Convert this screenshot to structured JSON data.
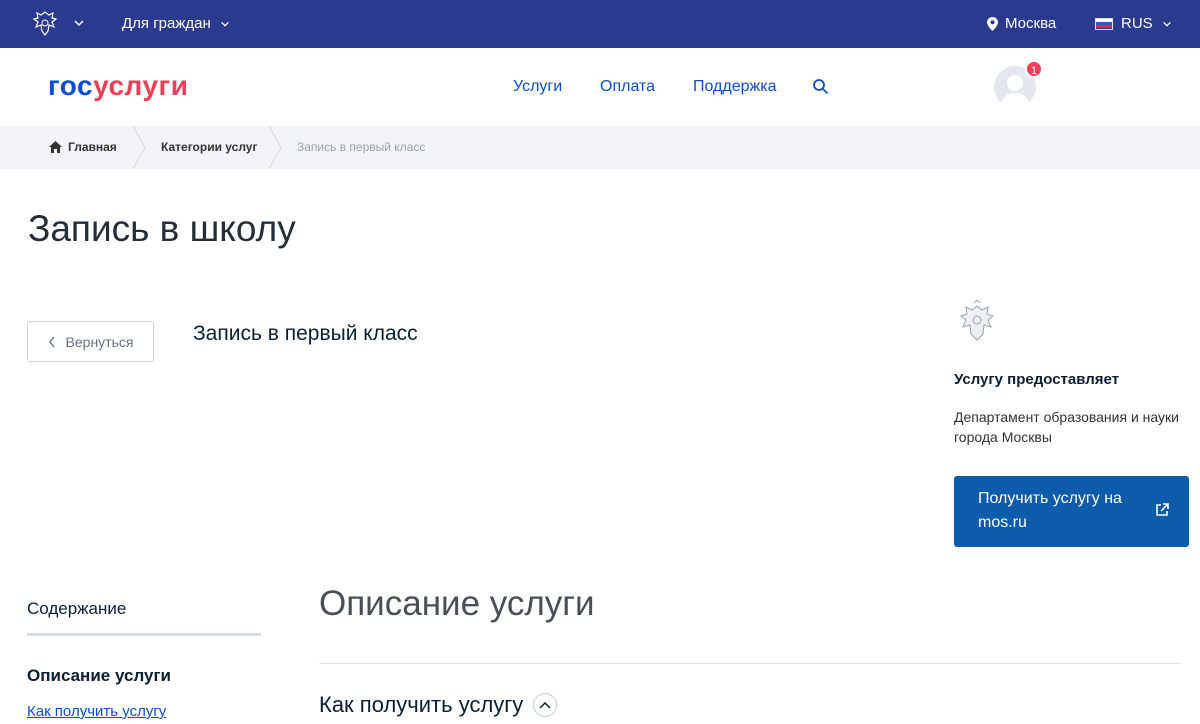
{
  "topbar": {
    "citizens_label": "Для граждан",
    "city_label": "Москва",
    "lang_label": "RUS"
  },
  "header": {
    "logo_part1": "гос",
    "logo_part2": "услуги",
    "nav": [
      "Услуги",
      "Оплата",
      "Поддержка"
    ],
    "notifications_count": "1"
  },
  "breadcrumbs": {
    "home": "Главная",
    "category": "Категории услуг",
    "current": "Запись в первый класс"
  },
  "main": {
    "page_title": "Запись в школу",
    "back_label": "Вернуться",
    "service_name": "Запись в первый класс"
  },
  "provider": {
    "label": "Услугу предоставляет",
    "department": "Департамент образования и науки города Москвы",
    "get_service_label": "Получить услугу на mos.ru"
  },
  "contents": {
    "title": "Содержание",
    "active_item": "Описание услуги",
    "link_item": "Как получить услугу"
  },
  "description": {
    "section_title": "Описание услуги",
    "how_title": "Как получить услугу"
  },
  "colors": {
    "topbar": "#2a3a8e",
    "brand_blue": "#0d4cd3",
    "brand_red": "#ee3f58",
    "primary_button": "#0d5cab"
  }
}
